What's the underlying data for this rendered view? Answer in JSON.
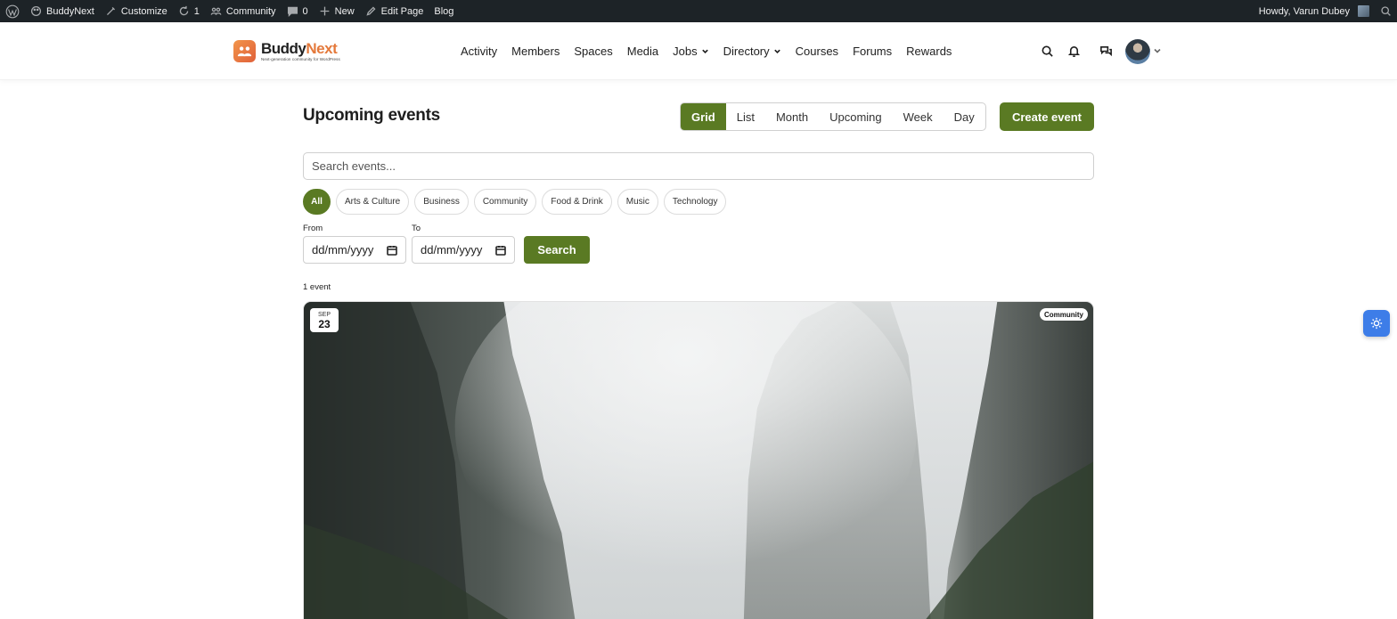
{
  "adminbar": {
    "items": [
      {
        "label": "BuddyNext",
        "icon": "palette-icon"
      },
      {
        "label": "Customize",
        "icon": "brush-icon"
      },
      {
        "label": "1",
        "icon": "refresh-icon"
      },
      {
        "label": "Community",
        "icon": "group-icon"
      },
      {
        "label": "0",
        "icon": "comment-icon"
      },
      {
        "label": "New",
        "icon": "plus-icon"
      },
      {
        "label": "Edit Page",
        "icon": "pencil-icon"
      },
      {
        "label": "Blog",
        "icon": ""
      }
    ],
    "howdy": "Howdy, Varun Dubey"
  },
  "header": {
    "logo_name_a": "Buddy",
    "logo_name_b": "Next",
    "logo_tagline": "Next-generation community for WordPress",
    "nav": [
      {
        "label": "Activity",
        "dropdown": false
      },
      {
        "label": "Members",
        "dropdown": false
      },
      {
        "label": "Spaces",
        "dropdown": false
      },
      {
        "label": "Media",
        "dropdown": false
      },
      {
        "label": "Jobs",
        "dropdown": true
      },
      {
        "label": "Directory",
        "dropdown": true
      },
      {
        "label": "Courses",
        "dropdown": false
      },
      {
        "label": "Forums",
        "dropdown": false
      },
      {
        "label": "Rewards",
        "dropdown": false
      }
    ]
  },
  "page": {
    "title": "Upcoming events",
    "views": [
      "Grid",
      "List",
      "Month",
      "Upcoming",
      "Week",
      "Day"
    ],
    "active_view": "Grid",
    "create_label": "Create event",
    "search_placeholder": "Search events...",
    "categories": [
      "All",
      "Arts & Culture",
      "Business",
      "Community",
      "Food & Drink",
      "Music",
      "Technology"
    ],
    "active_category": "All",
    "from_label": "From",
    "to_label": "To",
    "from_value": "dd/mm/yyyy",
    "to_value": "dd/mm/yyyy",
    "search_label": "Search",
    "count": "1 event"
  },
  "event": {
    "month": "SEP",
    "day": "23",
    "category": "Community"
  },
  "colors": {
    "primary": "#5a7a23",
    "admin_bar": "#1d2327",
    "toggle": "#3d7de8",
    "logo_orange": "#e4793b"
  }
}
